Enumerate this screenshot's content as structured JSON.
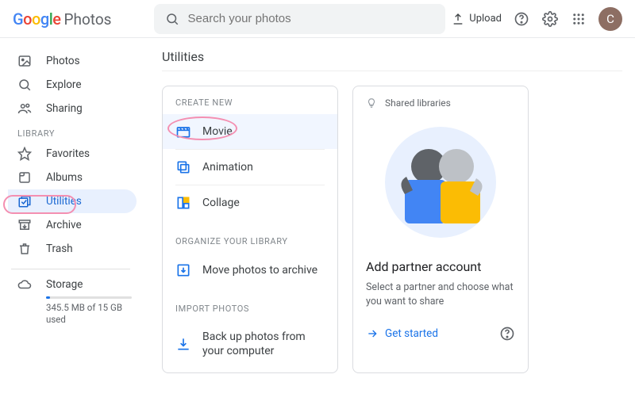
{
  "header": {
    "product": "Photos",
    "search_placeholder": "Search your photos",
    "upload_label": "Upload",
    "avatar_initial": "C"
  },
  "sidebar": {
    "items_top": [
      {
        "label": "Photos"
      },
      {
        "label": "Explore"
      },
      {
        "label": "Sharing"
      }
    ],
    "library_label": "LIBRARY",
    "items_lib": [
      {
        "label": "Favorites"
      },
      {
        "label": "Albums"
      },
      {
        "label": "Utilities"
      },
      {
        "label": "Archive"
      },
      {
        "label": "Trash"
      }
    ],
    "storage_label": "Storage",
    "storage_text": "345.5 MB of 15 GB used"
  },
  "main": {
    "title": "Utilities",
    "create_label": "CREATE NEW",
    "create_items": [
      {
        "label": "Movie"
      },
      {
        "label": "Animation"
      },
      {
        "label": "Collage"
      }
    ],
    "organize_label": "ORGANIZE YOUR LIBRARY",
    "organize_item": "Move photos to archive",
    "import_label": "IMPORT PHOTOS",
    "import_item": "Back up photos from your computer",
    "shared": {
      "head": "Shared libraries",
      "title": "Add partner account",
      "desc": "Select a partner and choose what you want to share",
      "cta": "Get started"
    }
  }
}
